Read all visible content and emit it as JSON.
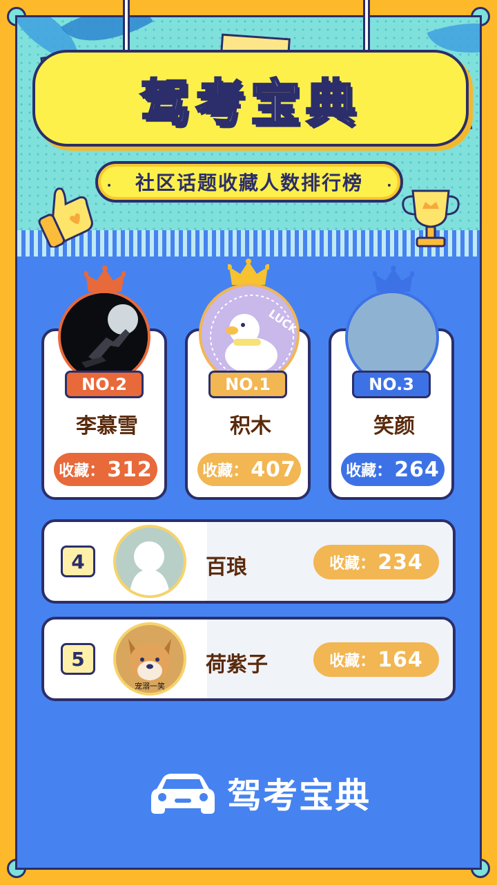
{
  "header": {
    "title": "驾考宝典",
    "subtitle": "社区话题收藏人数排行榜"
  },
  "score_label": "收藏：",
  "podium": [
    {
      "rank_label": "NO.2",
      "name": "李慕雪",
      "score": "312",
      "color": "#e8693a"
    },
    {
      "rank_label": "NO.1",
      "name": "积木",
      "score": "407",
      "color": "#f2b652"
    },
    {
      "rank_label": "NO.3",
      "name": "笑颜",
      "score": "264",
      "color": "#3d72e6"
    }
  ],
  "avatar_text": {
    "luck": "LUCK",
    "doge_caption": "宠溺一笑"
  },
  "list": [
    {
      "rank": "4",
      "name": "百琅",
      "score": "234"
    },
    {
      "rank": "5",
      "name": "荷紫子",
      "score": "164"
    }
  ],
  "footer": {
    "brand": "驾考宝典"
  },
  "colors": {
    "frame": "#fdb92a",
    "panel": "#4683f0",
    "outline": "#2b2e6a",
    "title_board": "#fef04a"
  }
}
